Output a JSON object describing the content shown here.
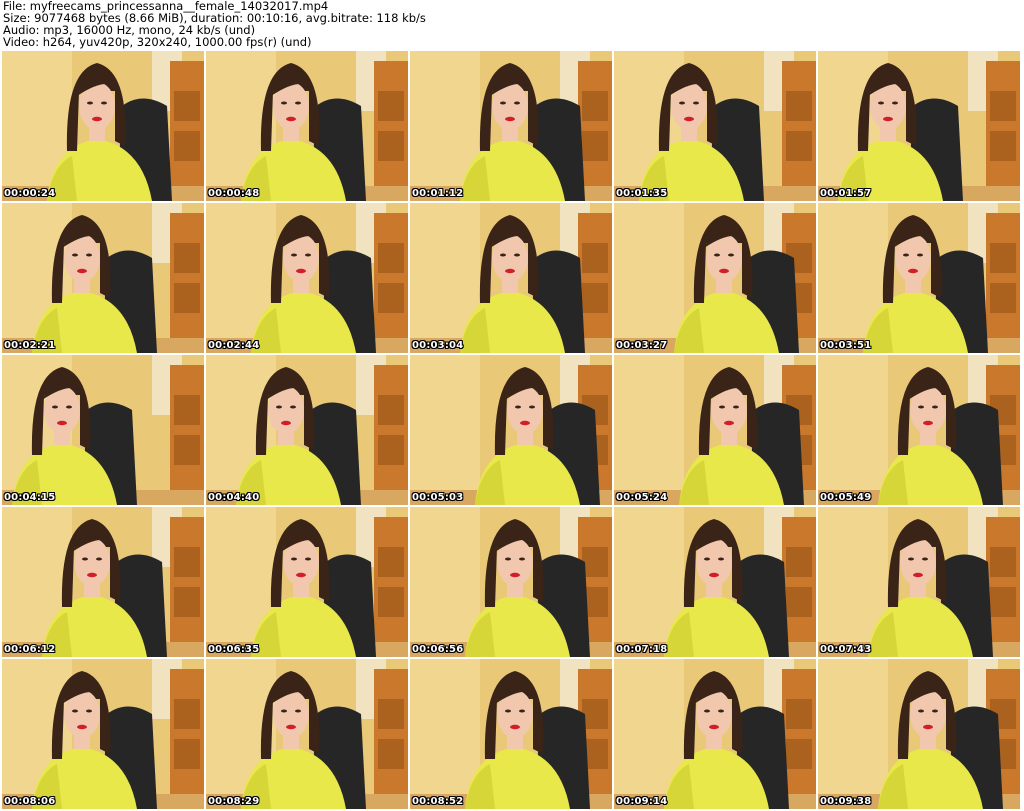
{
  "header": {
    "file_line": "File: myfreecams_princessanna__female_14032017.mp4",
    "size_line": "Size: 9077468 bytes (8.66 MiB), duration: 00:10:16, avg.bitrate: 118 kb/s",
    "audio_line": "Audio: mp3, 16000 Hz, mono, 24 kb/s (und)",
    "video_line": "Video: h264, yuv420p, 320x240, 1000.00 fps(r) (und)"
  },
  "thumbnails": [
    {
      "time": "00:00:24"
    },
    {
      "time": "00:00:48"
    },
    {
      "time": "00:01:12"
    },
    {
      "time": "00:01:35"
    },
    {
      "time": "00:01:57"
    },
    {
      "time": "00:02:21"
    },
    {
      "time": "00:02:44"
    },
    {
      "time": "00:03:04"
    },
    {
      "time": "00:03:27"
    },
    {
      "time": "00:03:51"
    },
    {
      "time": "00:04:15"
    },
    {
      "time": "00:04:40"
    },
    {
      "time": "00:05:03"
    },
    {
      "time": "00:05:24"
    },
    {
      "time": "00:05:49"
    },
    {
      "time": "00:06:12"
    },
    {
      "time": "00:06:35"
    },
    {
      "time": "00:06:56"
    },
    {
      "time": "00:07:18"
    },
    {
      "time": "00:07:43"
    },
    {
      "time": "00:08:06"
    },
    {
      "time": "00:08:29"
    },
    {
      "time": "00:08:52"
    },
    {
      "time": "00:09:14"
    },
    {
      "time": "00:09:38"
    }
  ],
  "colors": {
    "wall": "#e9c878",
    "wall_light": "#f3dc9a",
    "curtain": "#f4ead2",
    "cabinet": "#c9782c",
    "cabinet_dark": "#9a5418",
    "chair": "#262626",
    "sweater": "#e8e84a",
    "sweater_shade": "#cfcf30",
    "hair": "#3a2418",
    "skin": "#f1c8ae",
    "lips": "#d21e2a",
    "floor": "#d8a860"
  }
}
